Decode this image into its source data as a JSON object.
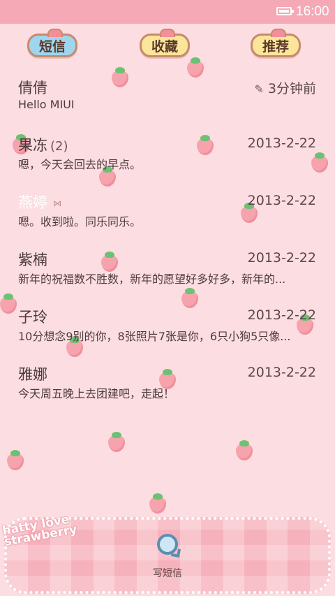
{
  "status": {
    "time": "16:00",
    "battery_icon": "battery-icon"
  },
  "tabs": [
    {
      "label": "短信"
    },
    {
      "label": "收藏"
    },
    {
      "label": "推荐"
    }
  ],
  "conversations": [
    {
      "name": "倩倩",
      "time": "3分钟前",
      "preview": "Hello MIUI",
      "count": ""
    },
    {
      "name": "果冻",
      "count": "(2)",
      "time": "2013-2-22",
      "preview": "嗯，今天会回去的早点。"
    },
    {
      "name": "燕婷",
      "time": "2013-2-22",
      "preview": "嗯。收到啦。同乐同乐。"
    },
    {
      "name": "紫楠",
      "time": "2013-2-22",
      "preview": "新年的祝福数不胜数，新年的愿望好多好多，新年的..."
    },
    {
      "name": "子玲",
      "time": "2013-2-22",
      "preview": "10分想念9别的你，8张照片7张是你，6只小狗5只像..."
    },
    {
      "name": "雅娜",
      "time": "2013-2-22",
      "preview": "今天周五晚上去团建吧，走起！"
    }
  ],
  "bottom": {
    "decor_text": "hatty love strawberry",
    "compose_label": "写短信"
  },
  "colors": {
    "background": "#fcdde2",
    "statusbar": "#f5a9b6",
    "tab_blue": "#9fd6ef",
    "tab_yellow": "#fbe59a"
  }
}
